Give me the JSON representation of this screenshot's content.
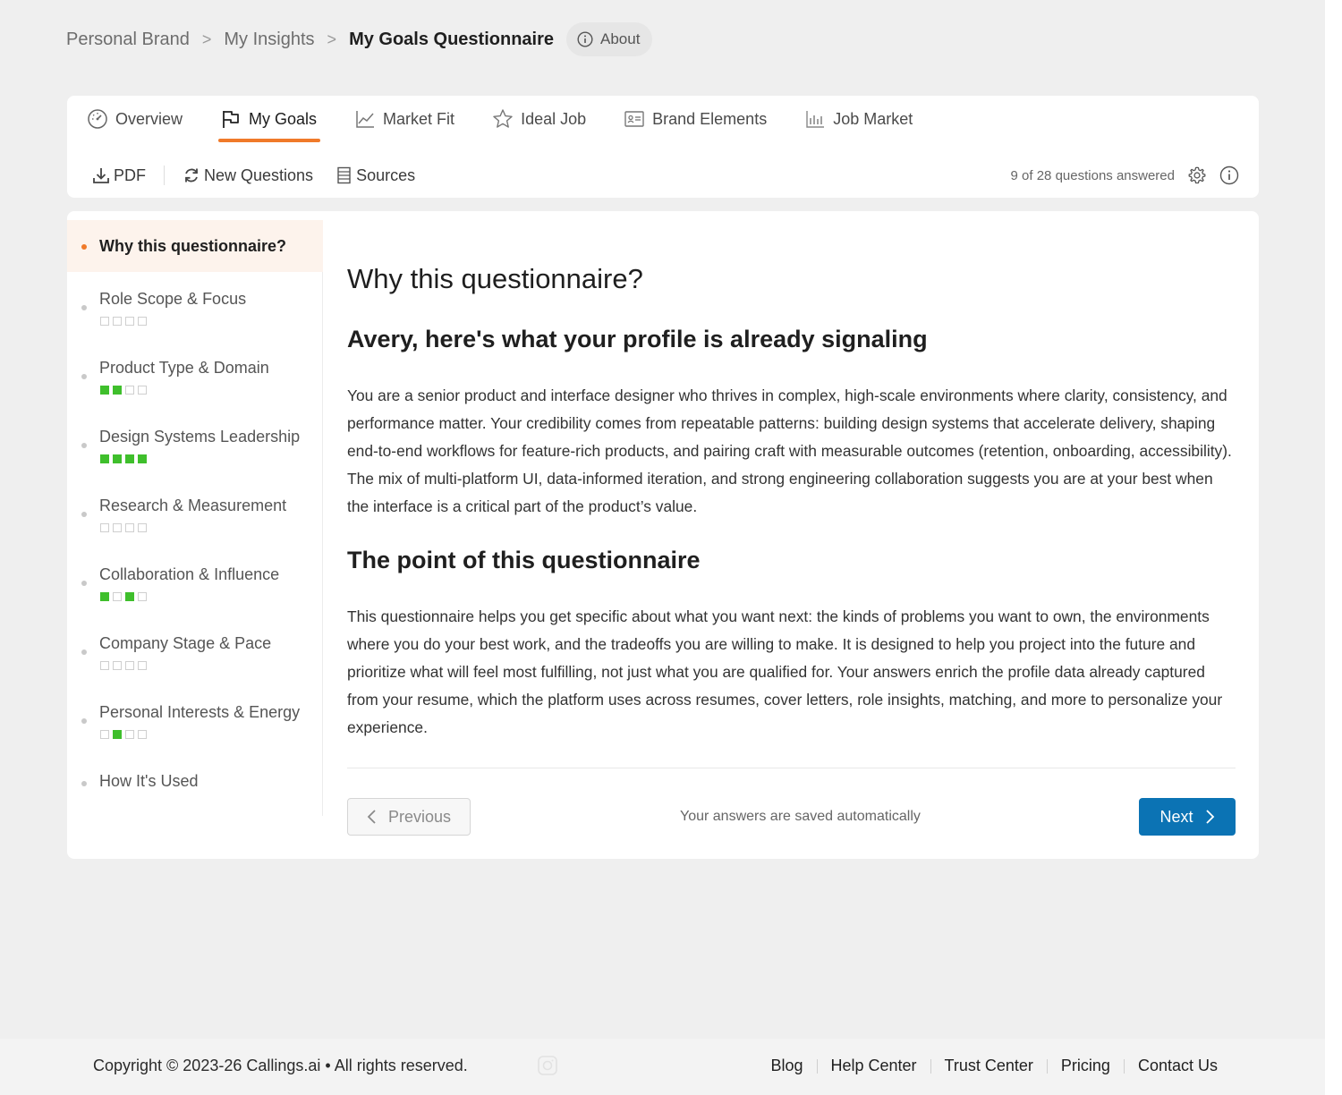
{
  "breadcrumb": {
    "items": [
      "Personal Brand",
      "My Insights"
    ],
    "separator": ">",
    "current": "My Goals Questionnaire",
    "about_label": "About"
  },
  "tabs": [
    {
      "label": "Overview",
      "icon": "dashboard-gauge-icon",
      "active": false
    },
    {
      "label": "My Goals",
      "icon": "flag-icon",
      "active": true
    },
    {
      "label": "Market Fit",
      "icon": "line-chart-icon",
      "active": false
    },
    {
      "label": "Ideal Job",
      "icon": "star-icon",
      "active": false
    },
    {
      "label": "Brand Elements",
      "icon": "id-card-icon",
      "active": false
    },
    {
      "label": "Job Market",
      "icon": "bar-chart-icon",
      "active": false
    }
  ],
  "toolbar": {
    "pdf_label": "PDF",
    "new_questions_label": "New Questions",
    "sources_label": "Sources",
    "answered_status": "9 of 28 questions answered"
  },
  "sidebar": {
    "items": [
      {
        "label": "Why this questionnaire?",
        "active": true,
        "progress": null
      },
      {
        "label": "Role Scope & Focus",
        "active": false,
        "progress": [
          0,
          0,
          0,
          0
        ]
      },
      {
        "label": "Product Type & Domain",
        "active": false,
        "progress": [
          1,
          1,
          0,
          0
        ]
      },
      {
        "label": "Design Systems Leadership",
        "active": false,
        "progress": [
          1,
          1,
          1,
          1
        ]
      },
      {
        "label": "Research & Measurement",
        "active": false,
        "progress": [
          0,
          0,
          0,
          0
        ]
      },
      {
        "label": "Collaboration & Influence",
        "active": false,
        "progress": [
          1,
          0,
          1,
          0
        ]
      },
      {
        "label": "Company Stage & Pace",
        "active": false,
        "progress": [
          0,
          0,
          0,
          0
        ]
      },
      {
        "label": "Personal Interests & Energy",
        "active": false,
        "progress": [
          0,
          1,
          0,
          0
        ]
      },
      {
        "label": "How It's Used",
        "active": false,
        "progress": null
      }
    ]
  },
  "content": {
    "title": "Why this questionnaire?",
    "section1_heading": "Avery, here's what your profile is already signaling",
    "section1_body": "You are a senior product and interface designer who thrives in complex, high-scale environments where clarity, consistency, and performance matter. Your credibility comes from repeatable patterns: building design systems that accelerate delivery, shaping end-to-end workflows for feature-rich products, and pairing craft with measurable outcomes (retention, onboarding, accessibility). The mix of multi-platform UI, data-informed iteration, and strong engineering collaboration suggests you are at your best when the interface is a critical part of the product’s value.",
    "section2_heading": "The point of this questionnaire",
    "section2_body": "This questionnaire helps you get specific about what you want next: the kinds of problems you want to own, the environments where you do your best work, and the tradeoffs you are willing to make. It is designed to help you project into the future and prioritize what will feel most fulfilling, not just what you are qualified for. Your answers enrich the profile data already captured from your resume, which the platform uses across resumes, cover letters, role insights, matching, and more to personalize your experience.",
    "previous_label": "Previous",
    "saved_note": "Your answers are saved automatically",
    "next_label": "Next"
  },
  "footer": {
    "copyright": "Copyright © 2023-26 Callings.ai • All rights reserved.",
    "links": [
      "Blog",
      "Help Center",
      "Trust Center",
      "Pricing",
      "Contact Us"
    ]
  },
  "colors": {
    "accent_orange": "#f07a2a",
    "primary_blue": "#0b73b4",
    "progress_green": "#3fbf2c"
  }
}
